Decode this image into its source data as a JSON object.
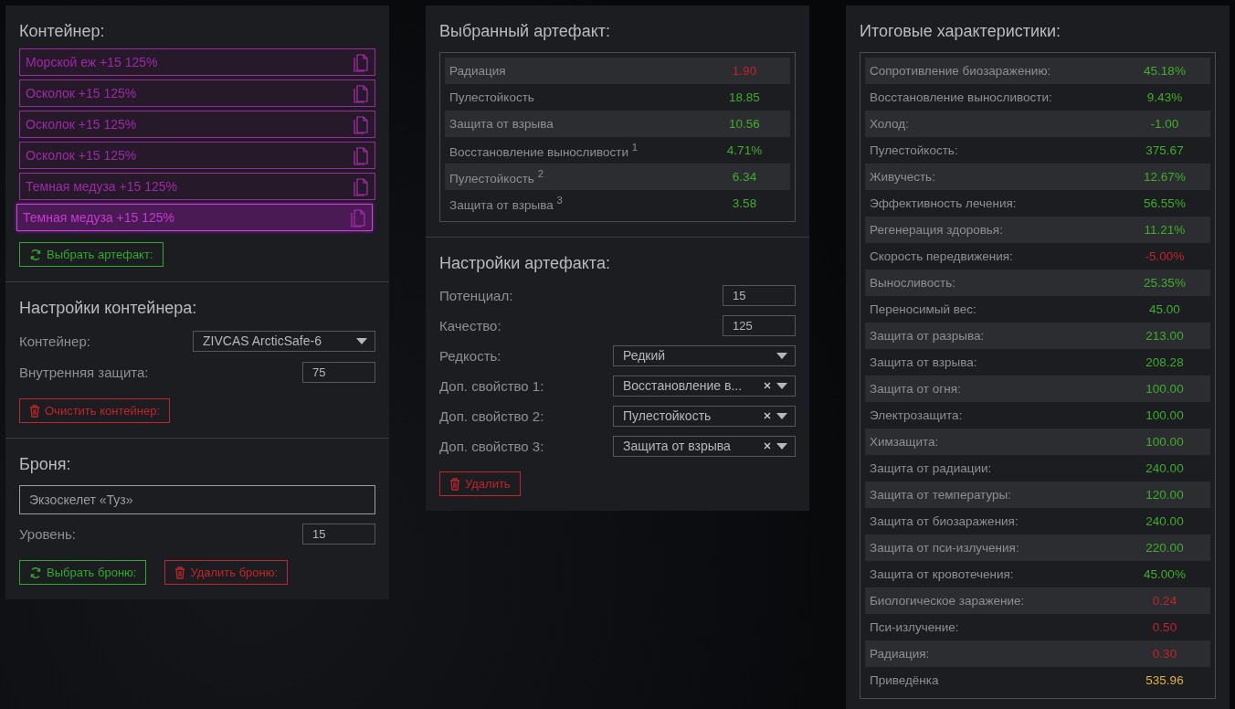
{
  "container_panel": {
    "title": "Контейнер:",
    "artifacts": [
      {
        "label": "Морской еж +15 125%",
        "selected": false
      },
      {
        "label": "Осколок +15 125%",
        "selected": false
      },
      {
        "label": "Осколок +15 125%",
        "selected": false
      },
      {
        "label": "Осколок +15 125%",
        "selected": false
      },
      {
        "label": "Темная медуза +15 125%",
        "selected": false
      },
      {
        "label": "Темная медуза +15 125%",
        "selected": true
      }
    ],
    "pick_button": {
      "label": "Выбрать артефакт:",
      "kind": "refresh"
    },
    "settings_title": "Настройки контейнера:",
    "fields": [
      {
        "kind": "select",
        "label": "Контейнер:",
        "value": "ZIVCAS ArcticSafe-6",
        "clearable": false
      },
      {
        "kind": "number",
        "label": "Внутренняя защита:",
        "value": "75"
      }
    ],
    "clear_button": {
      "label": "Очистить контейнер:",
      "kind": "delete"
    },
    "armor_title": "Броня:",
    "armor_name": "Экзоскелет «Туз»",
    "armor_fields": [
      {
        "kind": "number",
        "label": "Уровень:",
        "value": "15"
      }
    ],
    "armor_buttons": [
      {
        "label": "Выбрать броню:",
        "kind": "refresh"
      },
      {
        "label": "Удалить броню:",
        "kind": "delete"
      }
    ]
  },
  "artifact_panel": {
    "title": "Выбранный артефакт:",
    "stats": [
      {
        "name": "Радиация",
        "value": "1.90",
        "color": "#c0262a"
      },
      {
        "name": "Пулестойкость",
        "value": "18.85",
        "color": "#3fae2a"
      },
      {
        "name": "Защита от взрыва",
        "value": "10.56",
        "color": "#3fae2a"
      },
      {
        "name": "Восстановление выносливости $^{1}$",
        "value": "4.71%",
        "color": "#3fae2a"
      },
      {
        "name": "Пулестойкость $^{2}$",
        "value": "6.34",
        "color": "#3fae2a"
      },
      {
        "name": "Защита от взрыва $^{3}$",
        "value": "3.58",
        "color": "#3fae2a"
      }
    ],
    "settings_title": "Настройки артефакта:",
    "fields": [
      {
        "kind": "number",
        "label": "Потенциал:",
        "value": "15"
      },
      {
        "kind": "number",
        "label": "Качество:",
        "value": "125"
      },
      {
        "kind": "select",
        "label": "Редкость:",
        "value": "Редкий",
        "clearable": false
      },
      {
        "kind": "select",
        "label": "Доп. свойство 1:",
        "value": "Восстановление в...",
        "clearable": true
      },
      {
        "kind": "select",
        "label": "Доп. свойство 2:",
        "value": "Пулестойкость",
        "clearable": true
      },
      {
        "kind": "select",
        "label": "Доп. свойство 3:",
        "value": "Защита от взрыва",
        "clearable": true
      }
    ],
    "delete_button": {
      "label": "Удалить",
      "kind": "delete"
    }
  },
  "totals_panel": {
    "title": "Итоговые характеристики:",
    "stats": [
      {
        "name": "Сопротивление биозаражению:",
        "value": "45.18%",
        "color": "#3fae2a"
      },
      {
        "name": "Восстановление выносливости:",
        "value": "9.43%",
        "color": "#3fae2a"
      },
      {
        "name": "Холод:",
        "value": "-1.00",
        "color": "#3fae2a"
      },
      {
        "name": "Пулестойкость:",
        "value": "375.67",
        "color": "#3fae2a"
      },
      {
        "name": "Живучесть:",
        "value": "12.67%",
        "color": "#3fae2a"
      },
      {
        "name": "Эффективность лечения:",
        "value": "56.55%",
        "color": "#3fae2a"
      },
      {
        "name": "Регенерация здоровья:",
        "value": "11.21%",
        "color": "#3fae2a"
      },
      {
        "name": "Скорость передвижения:",
        "value": "-5.00%",
        "color": "#c0262a"
      },
      {
        "name": "Выносливость:",
        "value": "25.35%",
        "color": "#3fae2a"
      },
      {
        "name": "Переносимый вес:",
        "value": "45.00",
        "color": "#3fae2a"
      },
      {
        "name": "Защита от разрыва:",
        "value": "213.00",
        "color": "#3fae2a"
      },
      {
        "name": "Защита от взрыва:",
        "value": "208.28",
        "color": "#3fae2a"
      },
      {
        "name": "Защита от огня:",
        "value": "100.00",
        "color": "#3fae2a"
      },
      {
        "name": "Электрозащита:",
        "value": "100.00",
        "color": "#3fae2a"
      },
      {
        "name": "Химзащита:",
        "value": "100.00",
        "color": "#3fae2a"
      },
      {
        "name": "Защита от радиации:",
        "value": "240.00",
        "color": "#3fae2a"
      },
      {
        "name": "Защита от температуры:",
        "value": "120.00",
        "color": "#3fae2a"
      },
      {
        "name": "Защита от биозаражения:",
        "value": "240.00",
        "color": "#3fae2a"
      },
      {
        "name": "Защита от пси-излучения:",
        "value": "220.00",
        "color": "#3fae2a"
      },
      {
        "name": "Защита от кровотечения:",
        "value": "45.00%",
        "color": "#3fae2a"
      },
      {
        "name": "Биологическое заражение:",
        "value": "0.24",
        "color": "#c0262a"
      },
      {
        "name": "Пси-излучение:",
        "value": "0.50",
        "color": "#c0262a"
      },
      {
        "name": "Радиация:",
        "value": "0.30",
        "color": "#c0262a"
      },
      {
        "name": "Приведёнка",
        "value": "535.96",
        "color": "#e0b236"
      }
    ]
  }
}
